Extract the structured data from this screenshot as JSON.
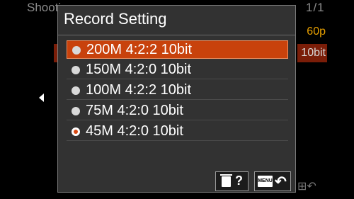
{
  "background": {
    "header": "Shooti          -                      -     -",
    "page_indicator": "1/1",
    "row1_value": "60p",
    "row2_value": "10bit",
    "bottom_icons": "⊞↶"
  },
  "dialog": {
    "title": "Record Setting",
    "options": [
      {
        "label": "200M 4:2:2 10bit",
        "selected": true,
        "checked": false
      },
      {
        "label": "150M 4:2:0 10bit",
        "selected": false,
        "checked": false
      },
      {
        "label": "100M 4:2:2 10bit",
        "selected": false,
        "checked": false
      },
      {
        "label": "75M 4:2:0 10bit",
        "selected": false,
        "checked": false
      },
      {
        "label": "45M 4:2:0 10bit",
        "selected": false,
        "checked": true
      }
    ],
    "footer": {
      "delete_help": "?",
      "menu_badge": "MENU",
      "back_symbol": "↶"
    }
  },
  "colors": {
    "accent": "#c8420c",
    "background": "#000000",
    "dialog_bg": "#323232"
  }
}
